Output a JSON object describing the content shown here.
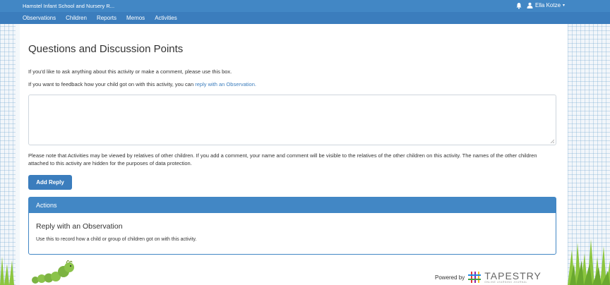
{
  "header": {
    "school_name": "Hamstel Infant School and Nursery R...",
    "user_name": "Ella Kotze",
    "user_caret": "▾"
  },
  "nav": {
    "items": [
      "Observations",
      "Children",
      "Reports",
      "Memos",
      "Activities"
    ]
  },
  "main": {
    "heading": "Questions and Discussion Points",
    "intro_line": "If you'd like to ask anything about this activity or make a comment, please use this box.",
    "feedback_prefix": "If you want to feedback how your child got on with this activity, you can ",
    "feedback_link": "reply with an Observation.",
    "reply_value": "",
    "privacy_note": "Please note that Activities may be viewed by relatives of other children. If you add a comment, your name and comment will be visible to the relatives of the other children on this activity. The names of the other children attached to this activity are hidden for the purposes of data protection.",
    "add_reply_label": "Add Reply"
  },
  "actions_panel": {
    "header": "Actions",
    "title": "Reply with an Observation",
    "description": "Use this to record how a child or group of children got on with this activity."
  },
  "footer": {
    "powered_by": "Powered by",
    "brand": "TAPESTRY",
    "brand_sub": "ONLINE LEARNING JOURNAL"
  },
  "colors": {
    "primary": "#4287c5",
    "nav": "#3b7dbd",
    "link": "#3b7dbd"
  },
  "icons": {
    "bell": "bell-icon",
    "user": "user-icon",
    "resize": "resize-handle-icon"
  }
}
